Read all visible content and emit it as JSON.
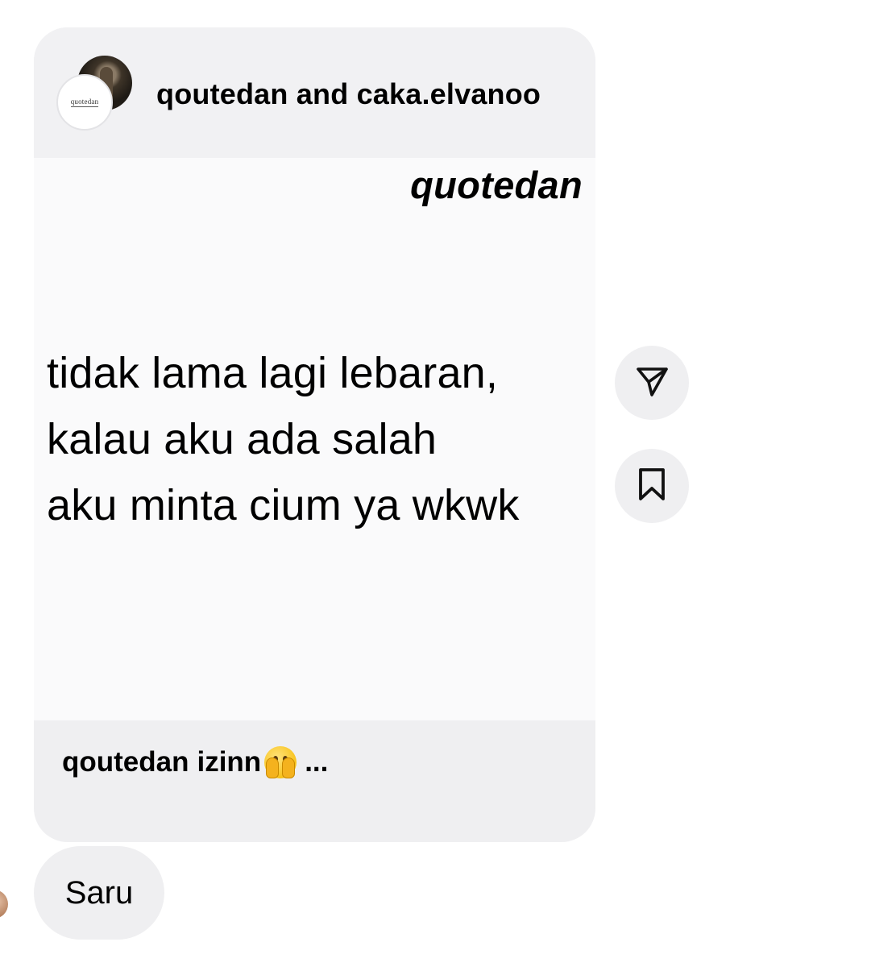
{
  "post": {
    "author": "qoutedan and caka.elvanoo",
    "avatar_text": "quotedan",
    "brand": "quotedan",
    "quote_lines": [
      "tidak lama lagi lebaran,",
      "kalau aku ada salah",
      "aku minta cium ya wkwk"
    ],
    "caption_user": "qoutedan",
    "caption_text": "izinn",
    "caption_emoji": "face-with-hands-over-eyes",
    "caption_ellipsis": "..."
  },
  "actions": {
    "share_icon": "send-icon",
    "save_icon": "bookmark-icon"
  },
  "message": {
    "text": "Saru"
  }
}
